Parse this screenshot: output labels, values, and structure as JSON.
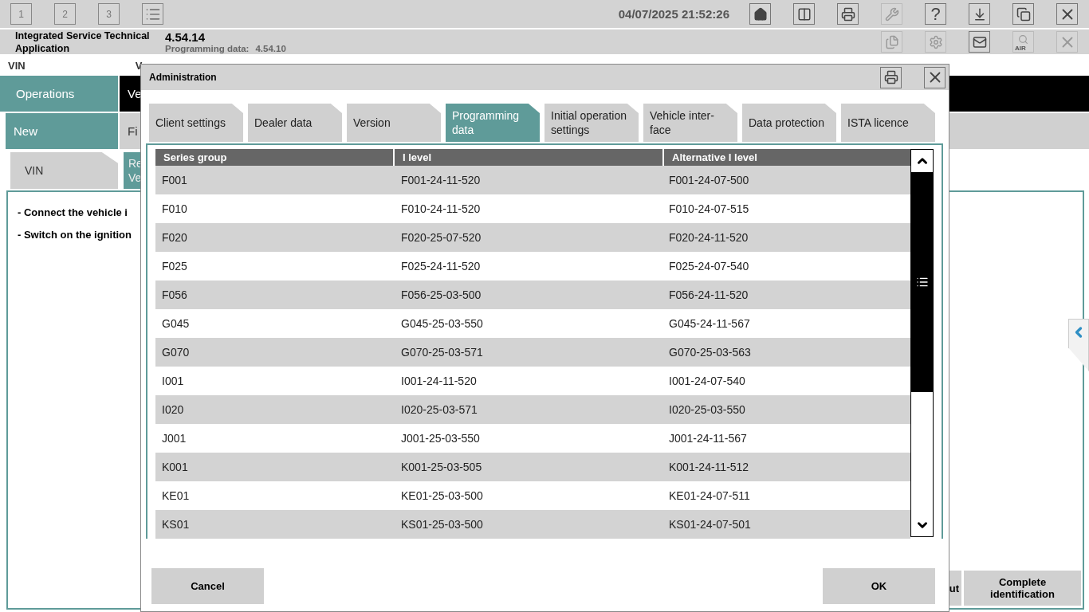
{
  "top_bar": {
    "screens": [
      {
        "label": "1"
      },
      {
        "label": "2"
      },
      {
        "label": "3"
      }
    ],
    "datetime": "04/07/2025 21:52:26",
    "tools": [
      {
        "kind": "home",
        "disabled": false
      },
      {
        "kind": "split",
        "disabled": false
      },
      {
        "kind": "print",
        "disabled": false
      },
      {
        "kind": "wrench",
        "disabled": true
      },
      {
        "kind": "help",
        "label": "?",
        "disabled": false
      },
      {
        "kind": "download",
        "disabled": false
      },
      {
        "kind": "windows",
        "disabled": false
      },
      {
        "kind": "close",
        "disabled": false
      }
    ]
  },
  "header": {
    "app_name": "Integrated Service Technical Application",
    "version": "4.54.14",
    "programming_data_label": "Programming data:",
    "programming_data_value": "4.54.10",
    "tools": [
      {
        "kind": "copy",
        "disabled": true
      },
      {
        "kind": "gear",
        "disabled": true
      },
      {
        "kind": "mail",
        "disabled": false
      },
      {
        "kind": "air",
        "label": "AIR",
        "disabled": true
      },
      {
        "kind": "close",
        "disabled": true
      }
    ]
  },
  "vin_row": {
    "vin_label": "VIN",
    "vehicle_label": "V"
  },
  "main_tabs": [
    {
      "label": "Operations",
      "selected": true
    },
    {
      "label": "Ve",
      "selected": false
    }
  ],
  "sub_tabs": [
    {
      "label": "New",
      "selected": true
    },
    {
      "label": "Fi",
      "selected": false
    }
  ],
  "step_tabs": [
    {
      "label": "VIN",
      "selected": false
    },
    {
      "label": "Re Ve",
      "selected": true
    }
  ],
  "instructions": [
    "- Connect the vehicle i",
    "- Switch on the ignition"
  ],
  "action_buttons": [
    "ut",
    "Complete identification"
  ],
  "dialog": {
    "title": "Administration",
    "tabs": [
      {
        "label": "Client settings",
        "selected": false
      },
      {
        "label": "Dealer data",
        "selected": false
      },
      {
        "label": "Version",
        "selected": false
      },
      {
        "label": "Programming data",
        "selected": true
      },
      {
        "label": "Initial operation settings",
        "selected": false
      },
      {
        "label": "Vehicle inter-face",
        "selected": false
      },
      {
        "label": "Data protection",
        "selected": false
      },
      {
        "label": "ISTA licence",
        "selected": false
      }
    ],
    "table": {
      "columns": [
        "Series group",
        "I level",
        "Alternative I level"
      ],
      "rows": [
        [
          "F001",
          "F001-24-11-520",
          "F001-24-07-500"
        ],
        [
          "F010",
          "F010-24-11-520",
          "F010-24-07-515"
        ],
        [
          "F020",
          "F020-25-07-520",
          "F020-24-11-520"
        ],
        [
          "F025",
          "F025-24-11-520",
          "F025-24-07-540"
        ],
        [
          "F056",
          "F056-25-03-500",
          "F056-24-11-520"
        ],
        [
          "G045",
          "G045-25-03-550",
          "G045-24-11-567"
        ],
        [
          "G070",
          "G070-25-03-571",
          "G070-25-03-563"
        ],
        [
          "I001",
          "I001-24-11-520",
          "I001-24-07-540"
        ],
        [
          "I020",
          "I020-25-03-571",
          "I020-25-03-550"
        ],
        [
          "J001",
          "J001-25-03-550",
          "J001-24-11-567"
        ],
        [
          "K001",
          "K001-25-03-505",
          "K001-24-11-512"
        ],
        [
          "KE01",
          "KE01-25-03-500",
          "KE01-24-07-511"
        ],
        [
          "KS01",
          "KS01-25-03-500",
          "KS01-24-07-501"
        ]
      ]
    },
    "buttons": [
      "Cancel",
      "OK"
    ]
  }
}
